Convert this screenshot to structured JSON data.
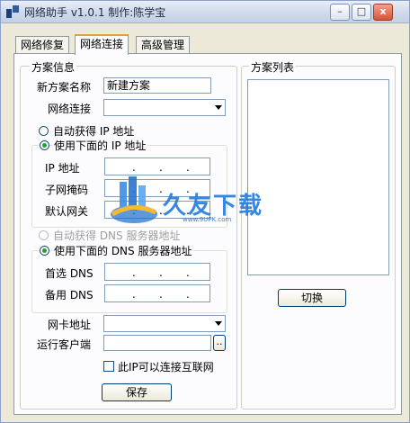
{
  "window": {
    "title": "网络助手 v1.0.1 制作:陈学宝",
    "minimize": "–",
    "maximize": "□",
    "close": "x"
  },
  "tabs": [
    {
      "label": "网络修复",
      "active": false
    },
    {
      "label": "网络连接",
      "active": true
    },
    {
      "label": "高级管理",
      "active": false
    }
  ],
  "scheme_info": {
    "legend": "方案信息",
    "name_label": "新方案名称",
    "name_value": "新建方案",
    "conn_label": "网络连接",
    "conn_value": "",
    "ip_group": {
      "auto_label": "自动获得 IP 地址",
      "manual_label": "使用下面的 IP 地址",
      "selected": "manual",
      "ip_label": "IP 地址",
      "mask_label": "子网掩码",
      "gateway_label": "默认网关"
    },
    "dns_group": {
      "auto_label": "自动获得 DNS 服务器地址",
      "manual_label": "使用下面的 DNS 服务器地址",
      "selected": "manual",
      "primary_label": "首选 DNS",
      "secondary_label": "备用 DNS"
    },
    "mac_label": "网卡地址",
    "mac_value": "",
    "client_label": "运行客户端",
    "client_value": "",
    "browse_label": "..",
    "internet_checkbox_label": "此IP可以连接互联网",
    "internet_checked": false,
    "save_label": "保存"
  },
  "scheme_list": {
    "legend": "方案列表",
    "items": [],
    "switch_label": "切换"
  },
  "watermark": {
    "text": "久友下载",
    "url": "www.9UPK.com"
  }
}
